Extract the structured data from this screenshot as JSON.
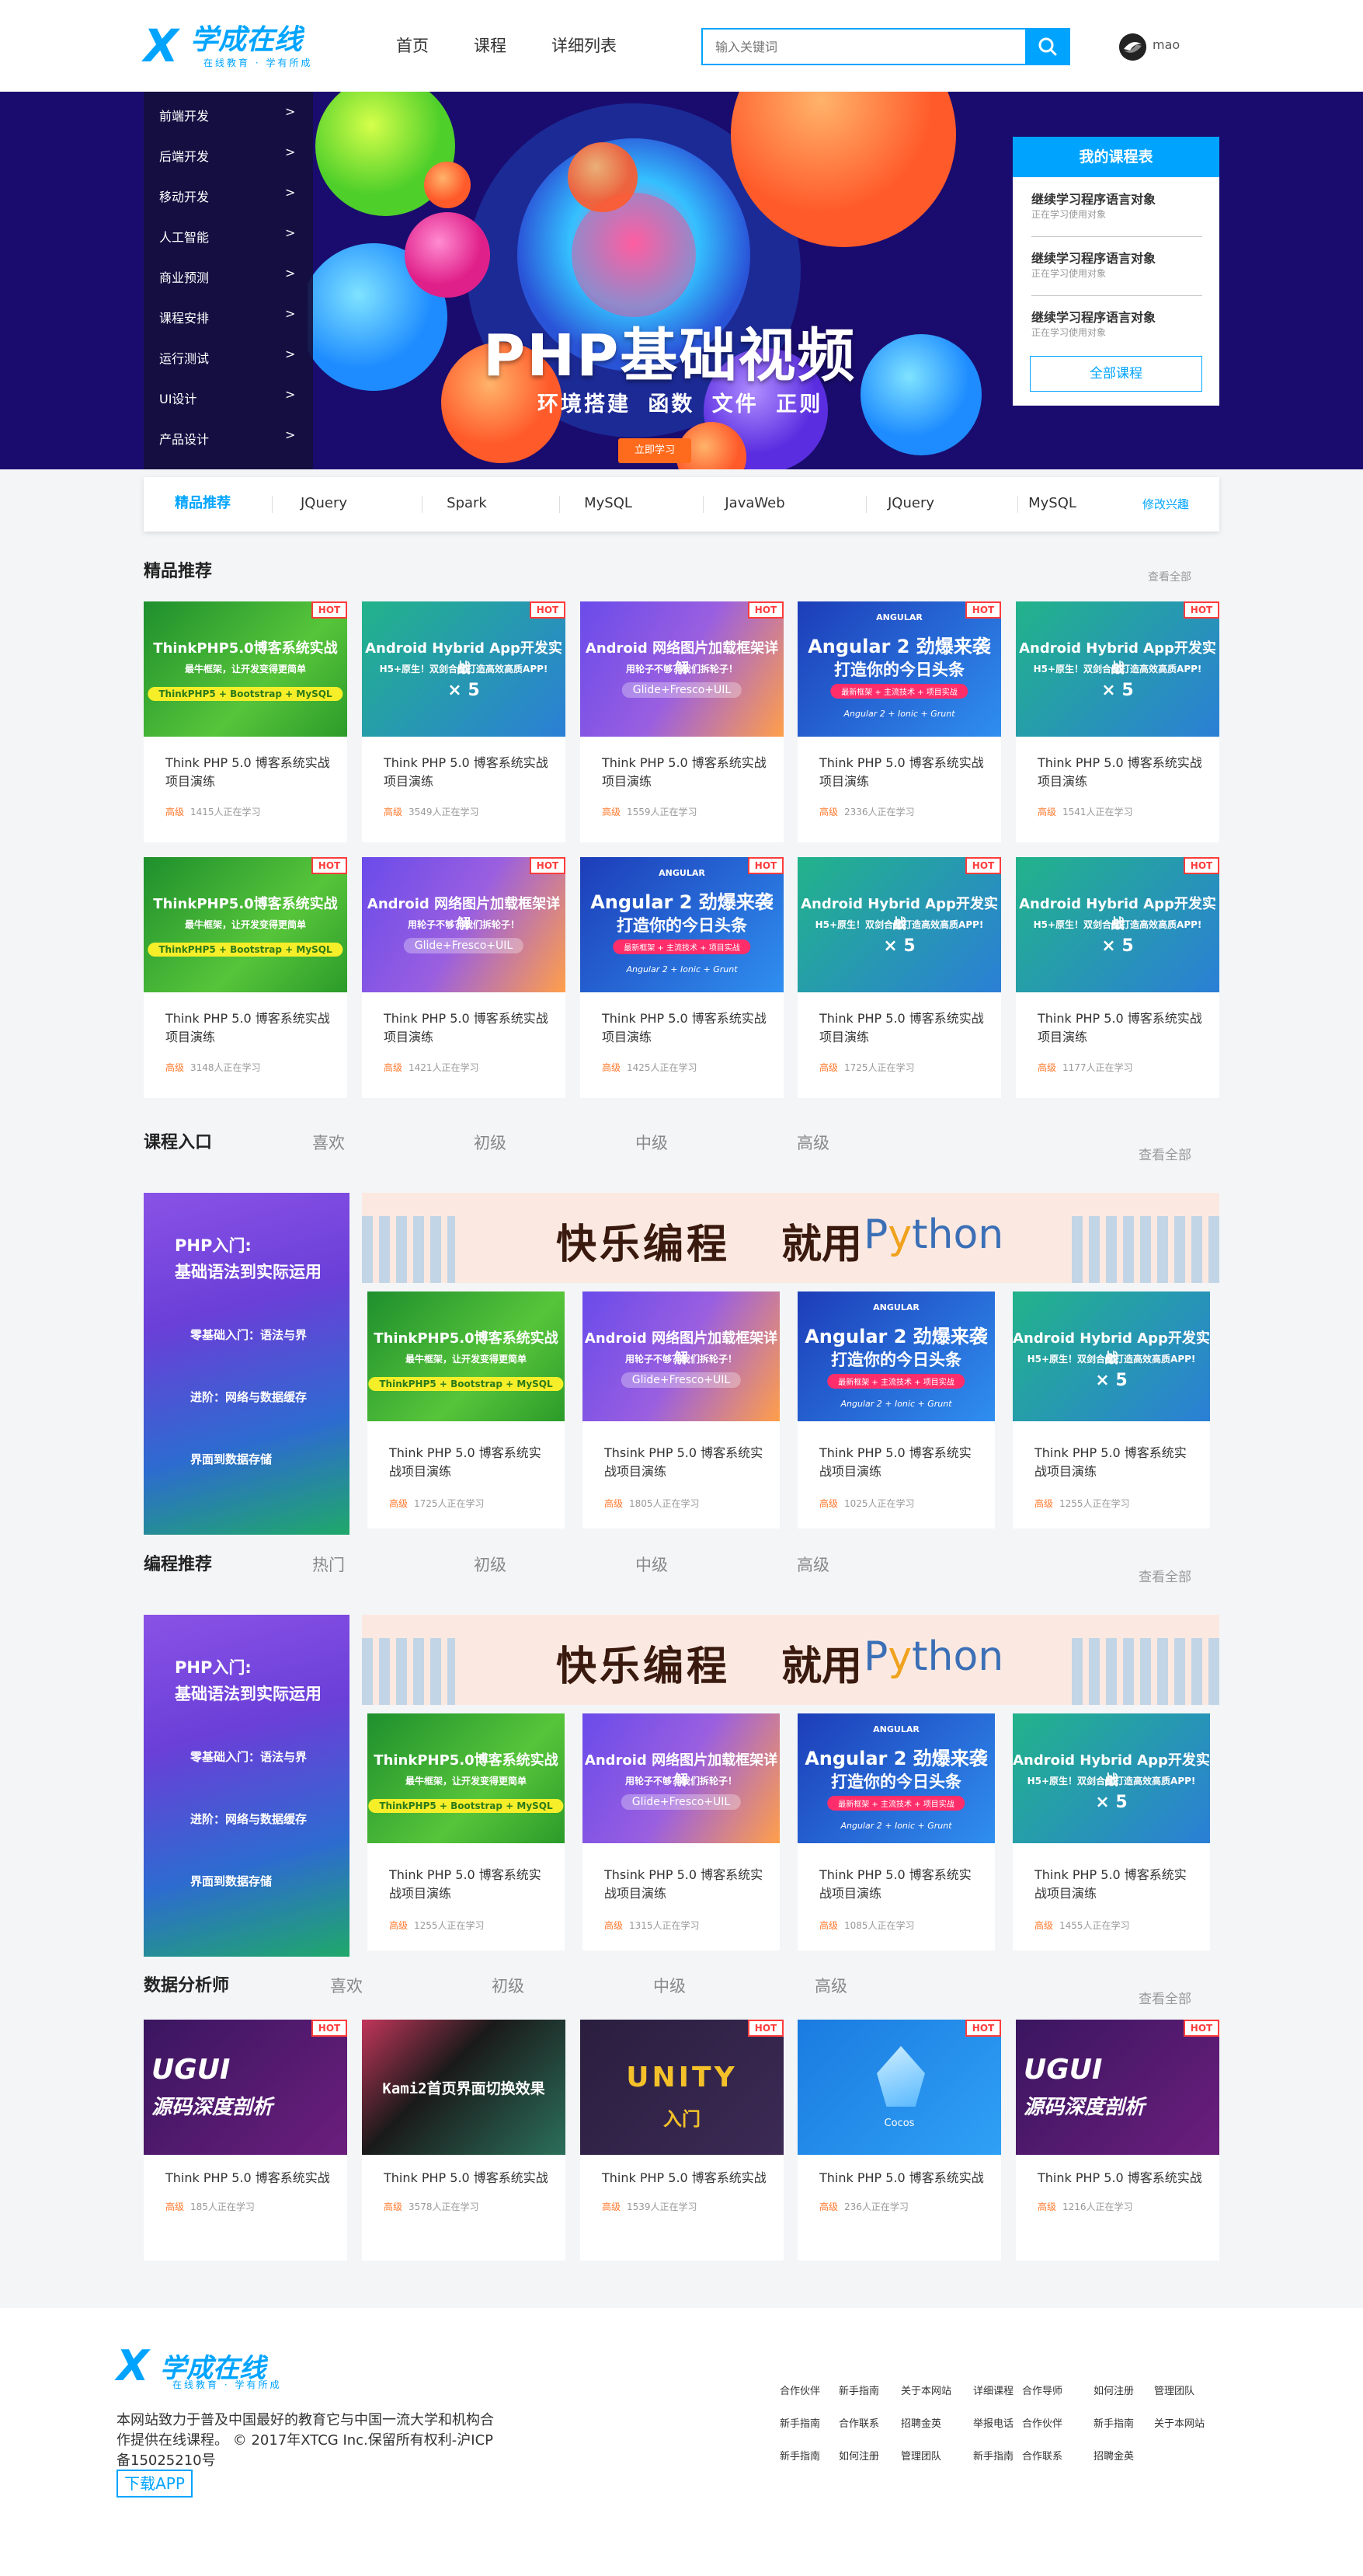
{
  "header": {
    "logo_mark": "X",
    "logo_name": "学成在线",
    "logo_slogan": "在线教育 · 学有所成",
    "nav": [
      "首页",
      "课程",
      "详细列表"
    ],
    "search_placeholder": "输入关键词",
    "user_name": "mao"
  },
  "banner": {
    "categories": [
      "前端开发",
      "后端开发",
      "移动开发",
      "人工智能",
      "商业预测",
      "课程安排",
      "运行测试",
      "UI设计",
      "产品设计"
    ],
    "arrow": ">",
    "title": "PHP基础视频",
    "subtitle": "环境搭建 函数 文件 正则",
    "button": "立即学习",
    "my_courses": {
      "heading": "我的课程表",
      "items": [
        {
          "title": "继续学习程序语言对象",
          "sub": "正在学习使用对象"
        },
        {
          "title": "继续学习程序语言对象",
          "sub": "正在学习使用对象"
        },
        {
          "title": "继续学习程序语言对象",
          "sub": "正在学习使用对象"
        }
      ],
      "all_button": "全部课程"
    }
  },
  "tabstrip": {
    "tabs": [
      "精品推荐",
      "JQuery",
      "Spark",
      "MySQL",
      "JavaWeb",
      "JQuery",
      "MySQL"
    ],
    "edit": "修改兴趣"
  },
  "sections": {
    "featured": {
      "title": "精品推荐",
      "more": "查看全部"
    },
    "entry": {
      "title": "课程入口",
      "tabs": [
        "喜欢",
        "初级",
        "中级",
        "高级"
      ],
      "more": "查看全部"
    },
    "programming": {
      "title": "编程推荐",
      "tabs": [
        "热门",
        "初级",
        "中级",
        "高级"
      ],
      "more": "查看全部"
    },
    "analyst": {
      "title": "数据分析师",
      "tabs": [
        "喜欢",
        "初级",
        "中级",
        "高级"
      ],
      "more": "查看全部"
    }
  },
  "hot_label": "HOT",
  "level_label": "高级",
  "featured_row1": [
    {
      "art": "thinkphp",
      "title": "Think PHP 5.0 博客系统实战项目演练",
      "count": "1415人正在学习"
    },
    {
      "art": "android",
      "title": "Think PHP 5.0 博客系统实战项目演练",
      "count": "3549人正在学习"
    },
    {
      "art": "glide",
      "title": "Think PHP 5.0 博客系统实战项目演练",
      "count": "1559人正在学习"
    },
    {
      "art": "angular",
      "title": "Think PHP 5.0 博客系统实战项目演练",
      "count": "2336人正在学习"
    },
    {
      "art": "android",
      "title": "Think PHP 5.0 博客系统实战项目演练",
      "count": "1541人正在学习"
    }
  ],
  "featured_row2": [
    {
      "art": "thinkphp",
      "title": "Think PHP 5.0 博客系统实战项目演练",
      "count": "3148人正在学习"
    },
    {
      "art": "glide",
      "title": "Think PHP 5.0 博客系统实战项目演练",
      "count": "1421人正在学习"
    },
    {
      "art": "angular",
      "title": "Think PHP 5.0 博客系统实战项目演练",
      "count": "1425人正在学习"
    },
    {
      "art": "android",
      "title": "Think PHP 5.0 博客系统实战项目演练",
      "count": "1725人正在学习"
    },
    {
      "art": "android",
      "title": "Think PHP 5.0 博客系统实战项目演练",
      "count": "1177人正在学习"
    }
  ],
  "card_art": {
    "thinkphp": {
      "t1": "ThinkPHP5.0博客系统实战",
      "t2": "最牛框架，让开发变得更简单",
      "pill": "ThinkPHP5 + Bootstrap + MySQL"
    },
    "android": {
      "t1": "Android Hybrid App开发实战",
      "t2": "H5+原生！双剑合璧打造高效高质APP!",
      "pill": "× 5"
    },
    "glide": {
      "t1": "Android 网络图片加载框架详解",
      "t2": "用轮子不够？我们拆轮子！",
      "pill": "Glide+Fresco+UIL"
    },
    "angular": {
      "t1": "Angular 2 劲爆来袭",
      "t2": "打造你的今日头条",
      "pill": "最新框架 + 主流技术 + 项目实战",
      "tag": "ANGULAR",
      "foot": "Angular 2 + Ionic + Grunt"
    }
  },
  "promo": {
    "line1": "PHP入门:",
    "line2": "基础语法到实际运用",
    "bullets": [
      "零基础入门：语法与界",
      "进阶：网络与数据缓存",
      "界面到数据存储"
    ]
  },
  "python_banner": {
    "t1": "快乐编程",
    "t2": "就用",
    "t3a": "P",
    "t3b": "y",
    "t3c": "thon"
  },
  "entry_cards": [
    {
      "art": "thinkphp",
      "title": "Think PHP 5.0 博客系统实战项目演练",
      "count": "1725人正在学习"
    },
    {
      "art": "glide",
      "title": "Thsink PHP 5.0 博客系统实战项目演练",
      "count": "1805人正在学习"
    },
    {
      "art": "angular",
      "title": "Think PHP 5.0 博客系统实战项目演练",
      "count": "1025人正在学习"
    },
    {
      "art": "android",
      "title": "Think PHP 5.0 博客系统实战项目演练",
      "count": "1255人正在学习"
    }
  ],
  "programming_cards": [
    {
      "art": "thinkphp",
      "title": "Think PHP 5.0 博客系统实战项目演练",
      "count": "1255人正在学习"
    },
    {
      "art": "glide",
      "title": "Thsink PHP 5.0 博客系统实战项目演练",
      "count": "1315人正在学习"
    },
    {
      "art": "angular",
      "title": "Think PHP 5.0 博客系统实战项目演练",
      "count": "1085人正在学习"
    },
    {
      "art": "android",
      "title": "Think PHP 5.0 博客系统实战项目演练",
      "count": "1455人正在学习"
    }
  ],
  "analyst_cards": [
    {
      "art": "ugui",
      "title": "Think PHP 5.0 博客系统实战",
      "count": "185人正在学习",
      "hot": true
    },
    {
      "art": "kami",
      "title": "Think PHP 5.0 博客系统实战",
      "count": "3578人正在学习",
      "hot": false
    },
    {
      "art": "unity",
      "title": "Think PHP 5.0 博客系统实战",
      "count": "1539人正在学习",
      "hot": true
    },
    {
      "art": "cocos",
      "title": "Think PHP 5.0 博客系统实战",
      "count": "236人正在学习",
      "hot": true
    },
    {
      "art": "ugui",
      "title": "Think PHP 5.0 博客系统实战",
      "count": "1216人正在学习",
      "hot": true
    }
  ],
  "analyst_art": {
    "ugui": {
      "t1": "UGUI",
      "t2": "源码深度剖析"
    },
    "kami": {
      "t1": "Kami2首页界面切换效果"
    },
    "unity": {
      "t1": "UNITY",
      "t2": "入门"
    },
    "cocos": {
      "t1": "Cocos"
    }
  },
  "footer": {
    "logo_mark": "X",
    "logo_name": "学成在线",
    "slogan": "在线教育 · 学有所成",
    "desc": "本网站致力于普及中国最好的教育它与中国一流大学和机构合作提供在线课程。 © 2017年XTCG Inc.保留所有权利-沪ICP备15025210号",
    "app": "下载APP",
    "links_row1": [
      "合作伙伴",
      "新手指南",
      "关于本网站",
      "详细课程",
      "合作导师",
      "如何注册",
      "管理团队"
    ],
    "links_row2": [
      "新手指南",
      "合作联系",
      "招聘金英",
      "举报电话",
      "合作伙伴",
      "新手指南",
      "关于本网站"
    ],
    "links_row3": [
      "新手指南",
      "如何注册",
      "管理团队",
      "新手指南",
      "合作联系",
      "招聘金英"
    ]
  },
  "colors": {
    "brand": "#00a4ff",
    "hot": "#ff3c3c",
    "level": "#ff7a2f",
    "banner_bg": "#1a0c6e"
  }
}
